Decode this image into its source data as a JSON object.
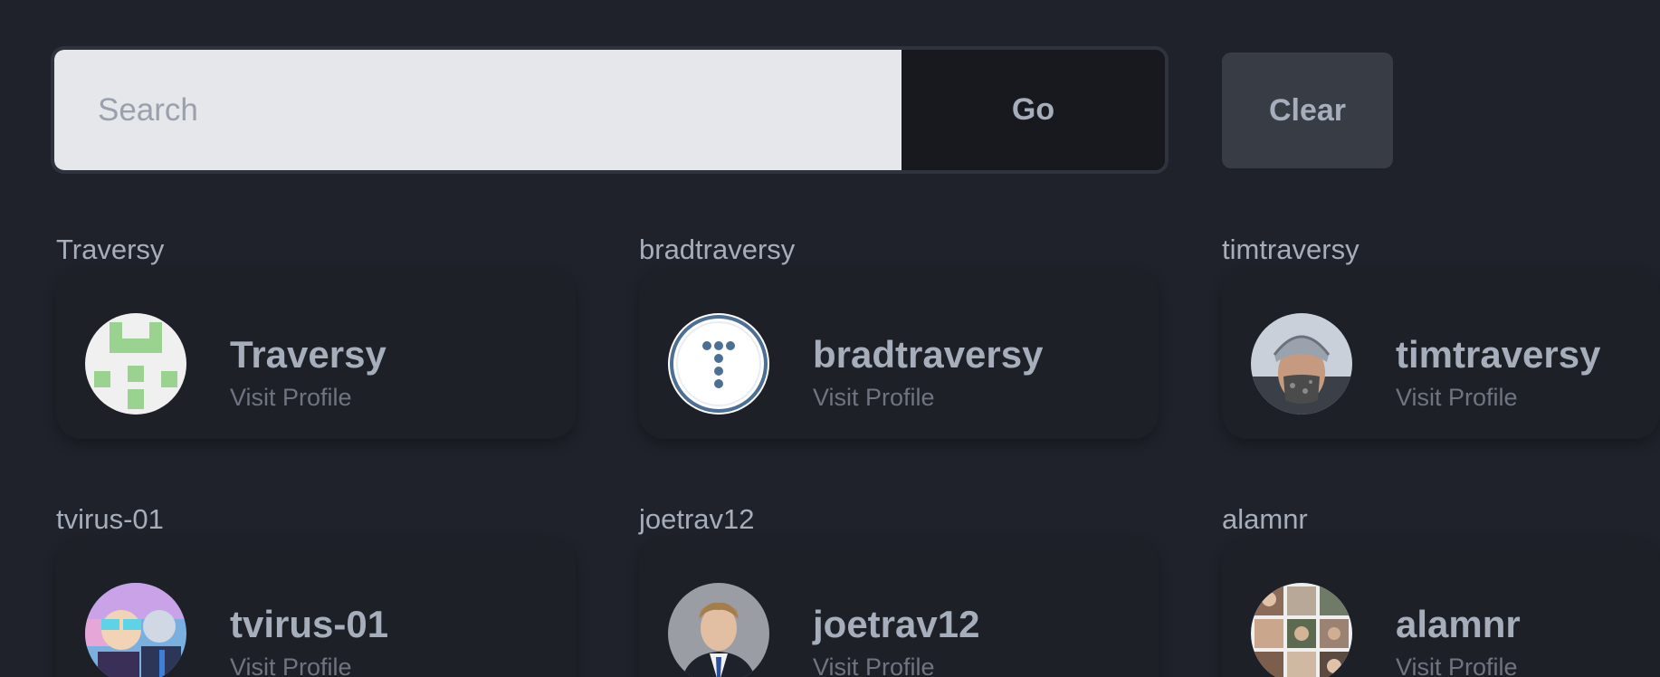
{
  "search": {
    "placeholder": "Search",
    "value": "",
    "go_label": "Go",
    "clear_label": "Clear"
  },
  "results": [
    {
      "label": "Traversy",
      "name": "Traversy",
      "link": "Visit Profile",
      "avatar": "identicon-green"
    },
    {
      "label": "bradtraversy",
      "name": "bradtraversy",
      "link": "Visit Profile",
      "avatar": "dots-logo"
    },
    {
      "label": "timtraversy",
      "name": "timtraversy",
      "link": "Visit Profile",
      "avatar": "person-helmet-photo"
    },
    {
      "label": "tvirus-01",
      "name": "tvirus-01",
      "link": "Visit Profile",
      "avatar": "cartoon-characters"
    },
    {
      "label": "joetrav12",
      "name": "joetrav12",
      "link": "Visit Profile",
      "avatar": "person-suit-photo"
    },
    {
      "label": "alamnr",
      "name": "alamnr",
      "link": "Visit Profile",
      "avatar": "photo-collage"
    }
  ],
  "colors": {
    "background": "#1f222a",
    "text": "#a6adbb",
    "muted": "#6e7480",
    "input_bg": "#e5e7eb",
    "button_dark": "#17191e",
    "button_clear": "#373c45"
  }
}
